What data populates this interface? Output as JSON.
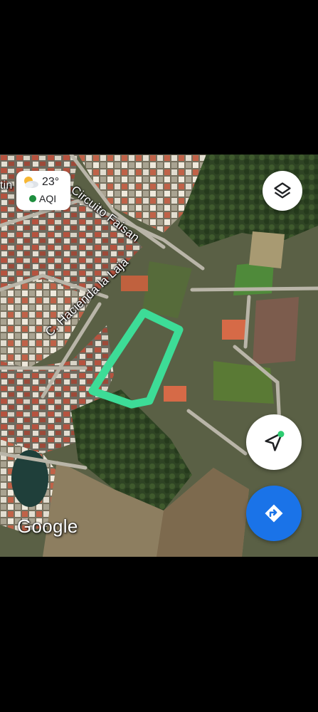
{
  "map": {
    "type": "satellite",
    "street_labels": {
      "circuito_faisan": "Circuito Faisan",
      "hacienda_la_laja": "C. Hacienda la Laja",
      "partial_left": "tin"
    },
    "highlight_color": "#3ddc97",
    "attribution": "Google"
  },
  "weather": {
    "temperature": "23°",
    "aqi_label": "AQI",
    "aqi_color": "#1e8e3e",
    "icon": "partly-cloudy-icon"
  },
  "controls": {
    "layers_icon": "layers-icon",
    "locate_icon": "navigation-arrow-icon",
    "directions_icon": "directions-icon",
    "directions_color": "#1a73e8"
  }
}
